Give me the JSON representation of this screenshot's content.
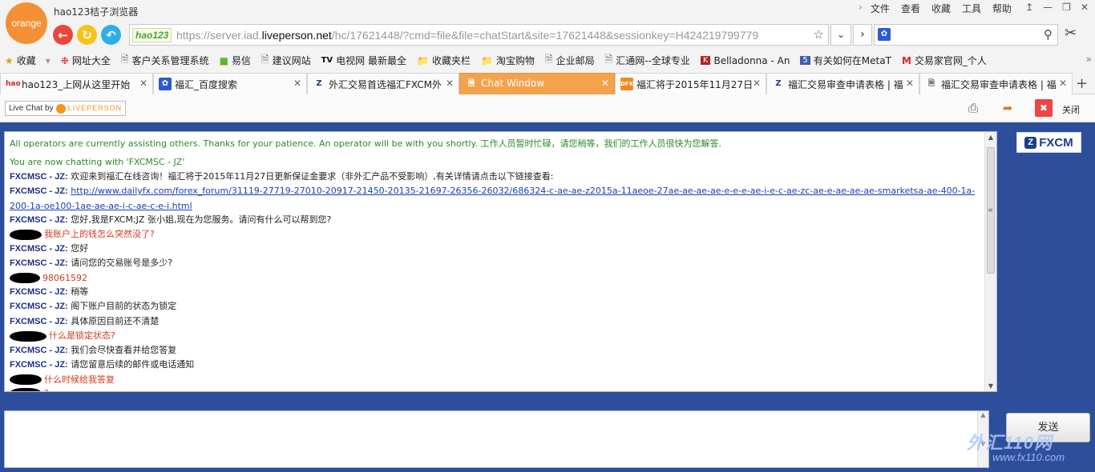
{
  "browser": {
    "logo_text": "orange",
    "title": "hao123桔子浏览器",
    "menu": [
      "文件",
      "查看",
      "收藏",
      "工具",
      "帮助"
    ],
    "address": {
      "badge": "hao123",
      "url_prefix": "https://server.iad.",
      "url_host": "liveperson.net",
      "url_rest": "/hc/17621448/?cmd=file&file=chatStart&site=17621448&sessionkey=H424219799779"
    }
  },
  "bookmarks": [
    {
      "icon": "star-icon",
      "label": "收藏"
    },
    {
      "icon": "hao123-icon",
      "label": "网址大全"
    },
    {
      "icon": "page-icon",
      "label": "客户关系管理系统"
    },
    {
      "icon": "yixin-icon",
      "label": "易信"
    },
    {
      "icon": "page-icon",
      "label": "建议网站"
    },
    {
      "icon": "tv-icon",
      "label": "电视网 最新最全"
    },
    {
      "icon": "folder-icon",
      "label": "收藏夹栏"
    },
    {
      "icon": "folder-icon",
      "label": "淘宝购物"
    },
    {
      "icon": "page-icon",
      "label": "企业邮局"
    },
    {
      "icon": "page-icon",
      "label": "汇通网--全球专业"
    },
    {
      "icon": "belladonna-icon",
      "label": "Belladonna - An"
    },
    {
      "icon": "five-icon",
      "label": "有关如何在MetaT"
    },
    {
      "icon": "m-icon",
      "label": "交易家官网_个人"
    }
  ],
  "tabs": [
    {
      "label": "hao123_上网从这里开始",
      "active": false
    },
    {
      "label": "福汇_百度搜索",
      "active": false
    },
    {
      "label": "外汇交易首选福汇FXCM外",
      "active": false
    },
    {
      "label": "Chat Window",
      "active": true
    },
    {
      "label": "福汇将于2015年11月27日",
      "active": false
    },
    {
      "label": "福汇交易审查申请表格 | 福",
      "active": false
    },
    {
      "label": "福汇交易审查申请表格 | 福",
      "active": false
    }
  ],
  "toolbar": {
    "lp_prefix": "Live Chat by",
    "lp_brand": "LIVEPERSON",
    "close_label": "关闭"
  },
  "brand": {
    "logo": "FXCM"
  },
  "chat": {
    "system_wait": "All operators are currently assisting others. Thanks for your patience. An operator will be with you shortly. 工作人员暂时忙碌，请您稍等，我们的工作人员很快为您解答.",
    "system_now": "You are now chatting with 'FXCMSC - JZ'",
    "agent_name": "FXCMSC - JZ:",
    "lines": [
      {
        "who": "agent",
        "text": "欢迎来到福汇在线咨询！福汇将于2015年11月27日更新保证金要求（非外汇产品不受影响）,有关详情请点击以下链接查看:"
      },
      {
        "who": "agent",
        "link": "http://www.dailyfx.com/forex_forum/31119-27719-27010-20917-21450-20135-21697-26356-26032/686324-c-ae-ae-z2015a-11aeoe-27ae-ae-ae-ae-e-e-e-ae-i-e-c-ae-zc-ae-e-ae-ae-ae-smarketsa-ae-400-1a-200-1a-oe100-1ae-ae-ae-i-c-ae-c-e-i.html"
      },
      {
        "who": "agent",
        "text": "您好,我是FXCM;JZ 张小姐,现在为您服务。请问有什么可以帮到您?"
      },
      {
        "who": "visitor",
        "text": "我账户上的钱怎么突然没了?"
      },
      {
        "who": "agent",
        "text": "您好"
      },
      {
        "who": "agent",
        "text": "请问您的交易账号是多少?"
      },
      {
        "who": "visitor",
        "text": "98061592"
      },
      {
        "who": "agent",
        "text": "稍等"
      },
      {
        "who": "agent",
        "text": "阁下账户目前的状态为锁定"
      },
      {
        "who": "agent",
        "text": "具体原因目前还不清楚"
      },
      {
        "who": "visitor",
        "text": "什么是锁定状态?"
      },
      {
        "who": "agent",
        "text": "我们会尽快查看并给您答复"
      },
      {
        "who": "agent",
        "text": "请您留意后续的邮件或电话通知"
      },
      {
        "who": "visitor",
        "text": "什么时候给我答复"
      },
      {
        "who": "visitor",
        "text": "?"
      }
    ]
  },
  "input": {
    "send_label": "发送",
    "value": ""
  },
  "watermark": {
    "text": "外汇110网",
    "url": "www.fx110.com"
  }
}
